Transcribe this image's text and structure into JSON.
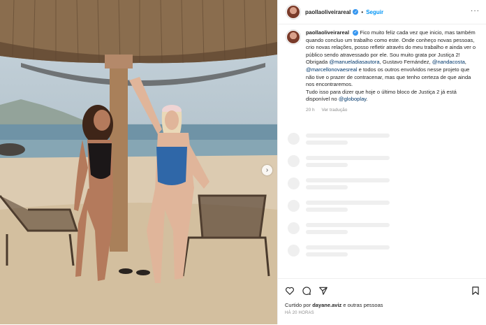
{
  "post": {
    "username": "paollaoliveirareal",
    "follow_label": "Seguir",
    "caption_parts": {
      "p1": "Fico muito feliz cada vez que inicio, mas também quando concluo um trabalho como este. Onde conheço novas pessoas, crio novas relações, posso refletir através do meu trabalho e ainda ver o público sendo atravessado por ele. Sou muito grata por Justiça 2! Obrigada ",
      "m1": "@manueladiasautora",
      "p2": ", Gustavo Fernández, ",
      "m2": "@nandacosta",
      "p3": ", ",
      "m3": "@marcellonovaesreal",
      "p4": " e todos os outros envolvidos nesse projeto que não tive o prazer de contracenar, mas que tenho certeza de que ainda nos encontraremos.",
      "p5": "Tudo isso para dizer que hoje o último bloco de Justiça 2 já está disponível no ",
      "m4": "@globoplay",
      "p6": "."
    },
    "caption_time": "20 h",
    "see_translation": "Ver tradução",
    "liked_prefix": "Curtido por ",
    "liked_user": "dayane.aviz",
    "liked_suffix": " e outras pessoas",
    "time_ago": "HÁ 20 HORAS"
  },
  "icons": {
    "verified": "verified-badge-icon",
    "like": "heart-icon",
    "comment": "comment-icon",
    "share": "paper-plane-icon",
    "save": "bookmark-icon",
    "more": "more-options-icon",
    "next": "chevron-right-icon"
  },
  "colors": {
    "accent": "#0095f6",
    "mention": "#00376b",
    "verified": "#3897f0",
    "muted": "#8e8e8e"
  }
}
